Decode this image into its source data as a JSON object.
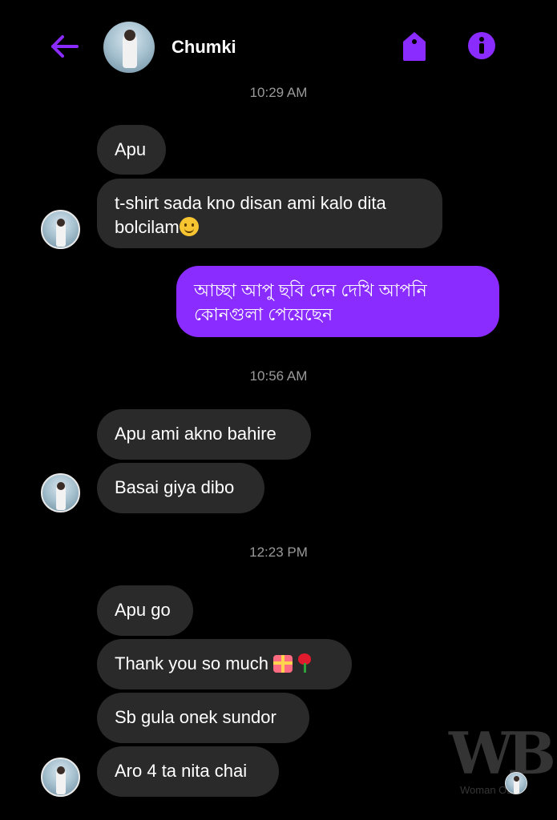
{
  "header": {
    "contact_name": "Chumki",
    "back_icon": "arrow-left-icon",
    "tag_icon": "tag-icon",
    "info_icon": "info-icon",
    "accent_color": "#8a2bff"
  },
  "messages": {
    "time1": "10:29 AM",
    "m1": "Apu",
    "m2": "t-shirt  sada kno disan ami kalo dita bolcilam",
    "m3": "আচ্ছা আপু ছবি দেন দেখি আপনি কোনগুলা পেয়েছেন",
    "time2": "10:56 AM",
    "m4": "Apu ami akno bahire",
    "m5": "Basai giya dibo",
    "time3": "12:23 PM",
    "m6": "Apu go",
    "m7": "Thank you so much",
    "m8": "Sb gula onek sundor",
    "m9": "Aro 4 ta nita chai"
  },
  "colors": {
    "incoming_bubble": "#2a2a2a",
    "outgoing_bubble": "#8a2bff",
    "background": "#000000",
    "timestamp": "#9a9a9a"
  },
  "watermark": {
    "logo": "WB",
    "text": "Woman OB"
  }
}
